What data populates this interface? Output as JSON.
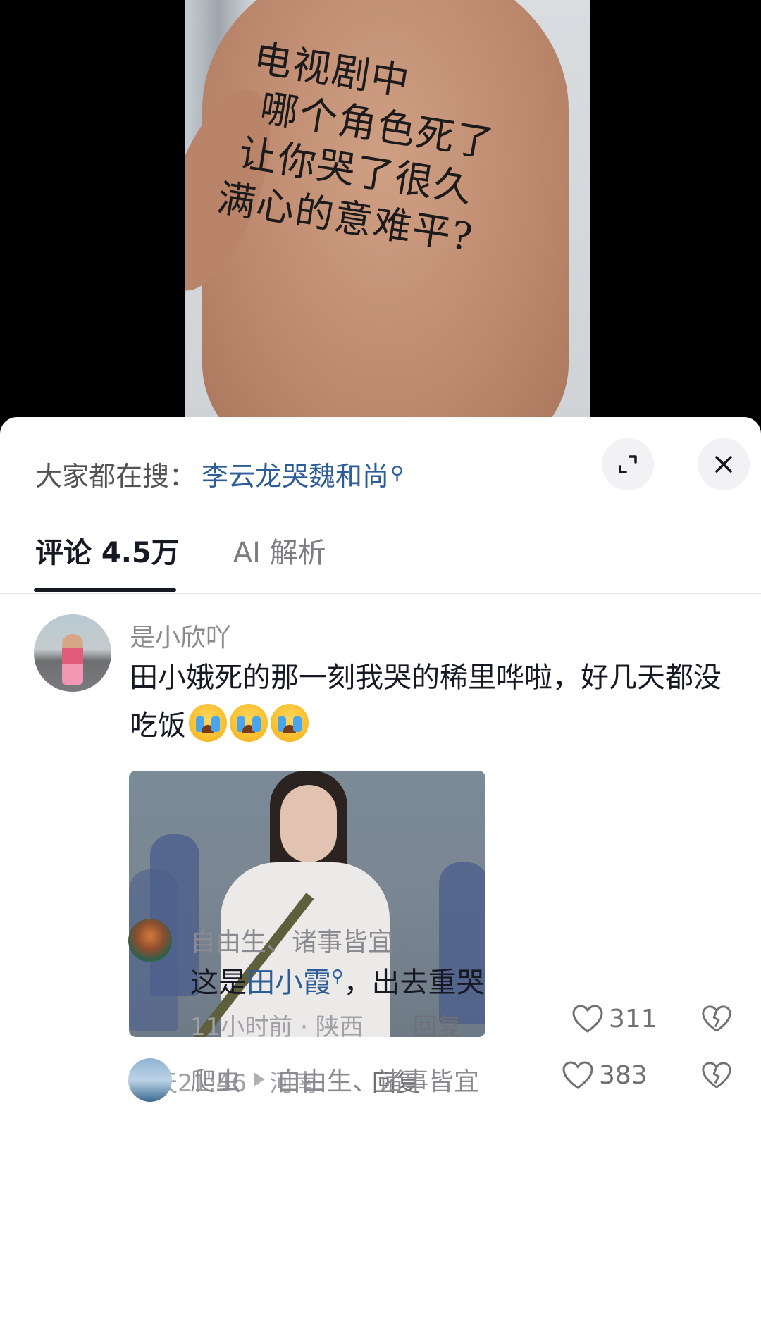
{
  "video": {
    "handwriting_lines": [
      "电视剧中",
      "哪个角色死了",
      "让你哭了很久",
      "满心的意难平?"
    ]
  },
  "search_bar": {
    "prefix": "大家都在搜：",
    "term": "李云龙哭魏和尚",
    "term_icon": "search-icon"
  },
  "tabs": [
    {
      "label": "评论 4.5万",
      "active": true
    },
    {
      "label": "AI 解析",
      "active": false
    }
  ],
  "comments": [
    {
      "username": "是小欣吖",
      "text": "田小娥死的那一刻我哭的稀里哗啦，好几天都没吃饭",
      "emoji_count": 3,
      "emoji_name": "crying-emoji",
      "time": "昨天21:46",
      "location": "河南",
      "reply_label": "回复",
      "likes": "383"
    },
    {
      "username": "自由生、诸事皆宜",
      "text_prefix": "这是",
      "text_highlight": "田小霞",
      "text_suffix": "，出去重哭",
      "time": "11小时前",
      "location": "陕西",
      "reply_label": "回复",
      "likes": "311"
    },
    {
      "username": "爬虫",
      "reply_to": "自由生、诸事皆宜"
    }
  ],
  "colors": {
    "link_blue": "#2c5d98",
    "text_primary": "#161823",
    "text_secondary": "#8a8b90"
  }
}
